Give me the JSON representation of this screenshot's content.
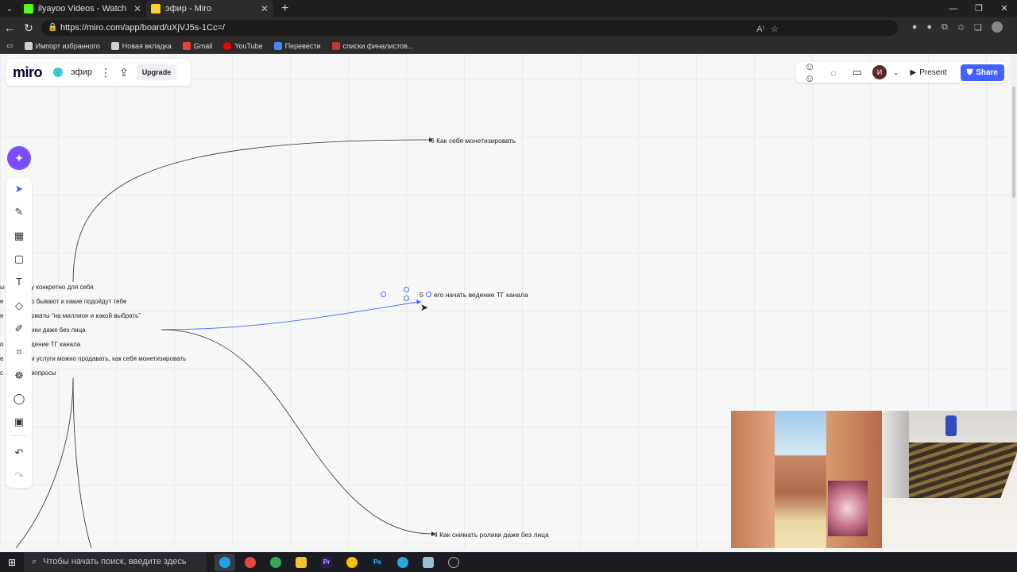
{
  "browser": {
    "tabs": [
      {
        "title": "ilyayoo Videos - Watch On-Dema",
        "favicon_color": "#53fc18"
      },
      {
        "title": "эфир - Miro",
        "favicon_color": "#ffd02f"
      }
    ],
    "url": "https://miro.com/app/board/uXjVJ5s-1Cc=/",
    "bookmarks": [
      {
        "label": "Импорт избранного",
        "color": "#cfcfcf"
      },
      {
        "label": "Новая вкладка",
        "color": "#cfcfcf"
      },
      {
        "label": "Gmail",
        "color": "#ea4335"
      },
      {
        "label": "YouTube",
        "color": "#ff0000"
      },
      {
        "label": "Перевести",
        "color": "#4285f4"
      },
      {
        "label": "списки финалистов...",
        "color": "#c0392b"
      }
    ]
  },
  "miro": {
    "logo": "miro",
    "board_name": "эфир",
    "upgrade_label": "Upgrade",
    "present_label": "Present",
    "share_label": "Share",
    "user_initial": "И",
    "accent_color": "#4262ff"
  },
  "mindmap": {
    "root_items": [
      "у конкретно для себя",
      "о бывают и какие подойдут тебе",
      "рматы \"на миллион и какой выбрать\"",
      "ики даже без лица",
      "дение ТГ канала",
      "и услуги можно продавать, как себя монетизировать",
      "вопросы"
    ],
    "left_fragments": [
      "ы",
      "е",
      "е",
      "о",
      "е",
      "с"
    ],
    "branch_6": "6 Как себя монетизировать",
    "branch_5_prefix": "5",
    "branch_5": "его начать ведение ТГ канала",
    "branch_4": "4 Как снимать ролики даже без лица"
  },
  "taskbar": {
    "search_placeholder": "Чтобы начать поиск, введите здесь"
  }
}
